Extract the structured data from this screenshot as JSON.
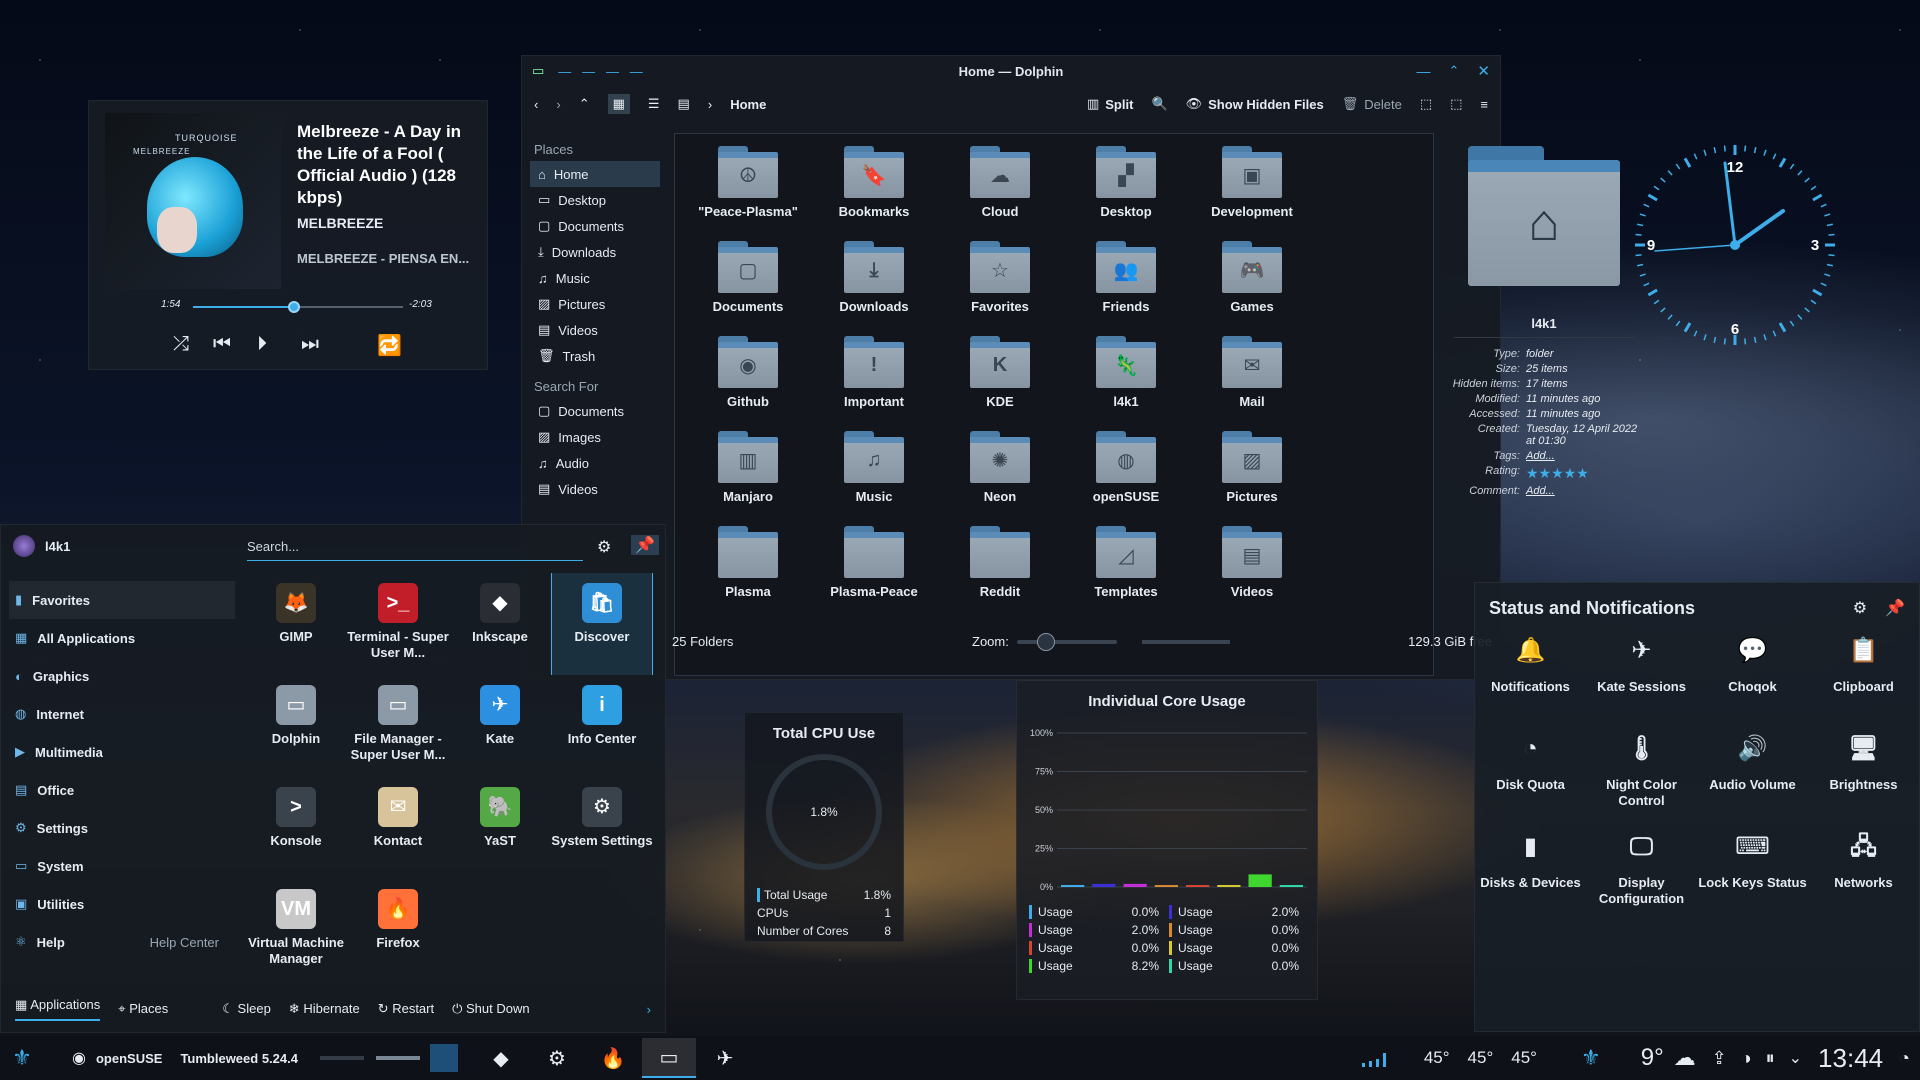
{
  "media": {
    "album_brand": "TURQUOISE",
    "album_sub": "MELBREEZE",
    "title": "Melbreeze - A Day in the Life of a Fool ( Official Audio ) (128 kbps)",
    "artist": "MELBREEZE",
    "album": "MELBREEZE - PIENSA EN...",
    "elapsed": "1:54",
    "remaining": "-2:03",
    "progress": 0.48
  },
  "dolphin": {
    "title": "Home — Dolphin",
    "breadcrumb": "Home",
    "split_label": "Split",
    "hidden_label": "Show Hidden Files",
    "delete_label": "Delete",
    "places_heading": "Places",
    "search_heading": "Search For",
    "places": [
      "Home",
      "Desktop",
      "Documents",
      "Downloads",
      "Music",
      "Pictures",
      "Videos",
      "Trash"
    ],
    "search_for": [
      "Documents",
      "Images",
      "Audio",
      "Videos"
    ],
    "folders": [
      {
        "name": "\"Peace-Plasma\"",
        "glyph": "☮"
      },
      {
        "name": "Bookmarks",
        "glyph": "🔖"
      },
      {
        "name": "Cloud",
        "glyph": "☁"
      },
      {
        "name": "Desktop",
        "glyph": "▞"
      },
      {
        "name": "Development",
        "glyph": "▣"
      },
      {
        "name": "Documents",
        "glyph": "▢"
      },
      {
        "name": "Downloads",
        "glyph": "⤓"
      },
      {
        "name": "Favorites",
        "glyph": "☆"
      },
      {
        "name": "Friends",
        "glyph": "👥"
      },
      {
        "name": "Games",
        "glyph": "🎮"
      },
      {
        "name": "Github",
        "glyph": "◉"
      },
      {
        "name": "Important",
        "glyph": "!"
      },
      {
        "name": "KDE",
        "glyph": "K"
      },
      {
        "name": "l4k1",
        "glyph": "🦎"
      },
      {
        "name": "Mail",
        "glyph": "✉"
      },
      {
        "name": "Manjaro",
        "glyph": "▥"
      },
      {
        "name": "Music",
        "glyph": "♫"
      },
      {
        "name": "Neon",
        "glyph": "✺"
      },
      {
        "name": "openSUSE",
        "glyph": "◍"
      },
      {
        "name": "Pictures",
        "glyph": "▨"
      },
      {
        "name": "Plasma",
        "glyph": ""
      },
      {
        "name": "Plasma-Peace",
        "glyph": ""
      },
      {
        "name": "Reddit",
        "glyph": ""
      },
      {
        "name": "Templates",
        "glyph": "◿"
      },
      {
        "name": "Videos",
        "glyph": "▤"
      }
    ],
    "status_count": "25 Folders",
    "zoom_label": "Zoom:",
    "free_space": "129.3 GiB free",
    "info": {
      "name": "l4k1",
      "rows": [
        {
          "k": "Type:",
          "v": "folder"
        },
        {
          "k": "Size:",
          "v": "25 items"
        },
        {
          "k": "Hidden items:",
          "v": "17 items"
        },
        {
          "k": "Modified:",
          "v": "11 minutes ago"
        },
        {
          "k": "Accessed:",
          "v": "11 minutes ago"
        },
        {
          "k": "Created:",
          "v": "Tuesday, 12 April 2022 at 01:30"
        },
        {
          "k": "Tags:",
          "v": "Add..."
        },
        {
          "k": "Rating:",
          "v": "★★★★★"
        },
        {
          "k": "Comment:",
          "v": "Add..."
        }
      ]
    }
  },
  "launcher": {
    "user": "l4k1",
    "search_placeholder": "Search...",
    "categories": [
      "Favorites",
      "All Applications",
      "Graphics",
      "Internet",
      "Multimedia",
      "Office",
      "Settings",
      "System",
      "Utilities",
      "Help"
    ],
    "help_center": "Help Center",
    "apps": [
      {
        "name": "GIMP",
        "glyph": "🦊",
        "color": "#3a3328"
      },
      {
        "name": "Terminal - Super User M...",
        "glyph": ">_",
        "color": "#c21e2a"
      },
      {
        "name": "Inkscape",
        "glyph": "◆",
        "color": "#2a2e34"
      },
      {
        "name": "Discover",
        "glyph": "🛍",
        "color": "#2f8fd6"
      },
      {
        "name": "Dolphin",
        "glyph": "▭",
        "color": "#8c9aa8"
      },
      {
        "name": "File Manager - Super User M...",
        "glyph": "▭",
        "color": "#8c9aa8"
      },
      {
        "name": "Kate",
        "glyph": "✈",
        "color": "#2d8fe0"
      },
      {
        "name": "Info Center",
        "glyph": "i",
        "color": "#2e9fe0"
      },
      {
        "name": "Konsole",
        "glyph": ">",
        "color": "#3a424c"
      },
      {
        "name": "Kontact",
        "glyph": "✉",
        "color": "#d8c49a"
      },
      {
        "name": "YaST",
        "glyph": "🐘",
        "color": "#54a845"
      },
      {
        "name": "System Settings",
        "glyph": "⚙",
        "color": "#3a424c"
      },
      {
        "name": "Virtual Machine Manager",
        "glyph": "VM",
        "color": "#c8c8c8"
      },
      {
        "name": "Firefox",
        "glyph": "🔥",
        "color": "#ff7139"
      }
    ],
    "footer": {
      "applications": "Applications",
      "places": "Places",
      "sleep": "Sleep",
      "hibernate": "Hibernate",
      "restart": "Restart",
      "shutdown": "Shut Down"
    }
  },
  "cpu": {
    "title": "Total CPU Use",
    "value": "1.8%",
    "rows": [
      {
        "k": "Total Usage",
        "v": "1.8%"
      },
      {
        "k": "CPUs",
        "v": "1"
      },
      {
        "k": "Number of Cores",
        "v": "8"
      }
    ]
  },
  "cores": {
    "title": "Individual Core Usage",
    "legend": [
      {
        "name": "Usage",
        "v": "0.0%",
        "color": "#3daee9"
      },
      {
        "name": "Usage",
        "v": "2.0%",
        "color": "#3b2fd6"
      },
      {
        "name": "Usage",
        "v": "2.0%",
        "color": "#c22fd6"
      },
      {
        "name": "Usage",
        "v": "0.0%",
        "color": "#d68a2f"
      },
      {
        "name": "Usage",
        "v": "0.0%",
        "color": "#d6452f"
      },
      {
        "name": "Usage",
        "v": "0.0%",
        "color": "#d6c82f"
      },
      {
        "name": "Usage",
        "v": "8.2%",
        "color": "#3fd62f"
      },
      {
        "name": "Usage",
        "v": "0.0%",
        "color": "#2fd6a8"
      }
    ]
  },
  "chart_data": {
    "type": "bar",
    "title": "Individual Core Usage",
    "yticks": [
      "100%",
      "75%",
      "50%",
      "25%",
      "0%"
    ],
    "ylim": [
      0,
      100
    ],
    "values": [
      0.0,
      2.0,
      2.0,
      0.0,
      0.0,
      0.0,
      8.2,
      0.0
    ]
  },
  "clock": {
    "labels": [
      "12",
      "3",
      "6",
      "9"
    ]
  },
  "status": {
    "title": "Status and Notifications",
    "items": [
      {
        "name": "Notifications",
        "glyph": "🔔"
      },
      {
        "name": "Kate Sessions",
        "glyph": "✈"
      },
      {
        "name": "Choqok",
        "glyph": "💬"
      },
      {
        "name": "Clipboard",
        "glyph": "📋"
      },
      {
        "name": "Disk Quota",
        "glyph": "◔"
      },
      {
        "name": "Night Color Control",
        "glyph": "🌡"
      },
      {
        "name": "Audio Volume",
        "glyph": "🔊"
      },
      {
        "name": "Brightness",
        "glyph": "🖥"
      },
      {
        "name": "Disks & Devices",
        "glyph": "▮"
      },
      {
        "name": "Display Configuration",
        "glyph": "🖵"
      },
      {
        "name": "Lock Keys Status",
        "glyph": "⌨"
      },
      {
        "name": "Networks",
        "glyph": "🖧"
      }
    ]
  },
  "taskbar": {
    "distro": "openSUSE",
    "version": "Tumbleweed 5.24.4",
    "temps": [
      "45°",
      "45°",
      "45°"
    ],
    "weather": "9°",
    "time": "13:44"
  }
}
